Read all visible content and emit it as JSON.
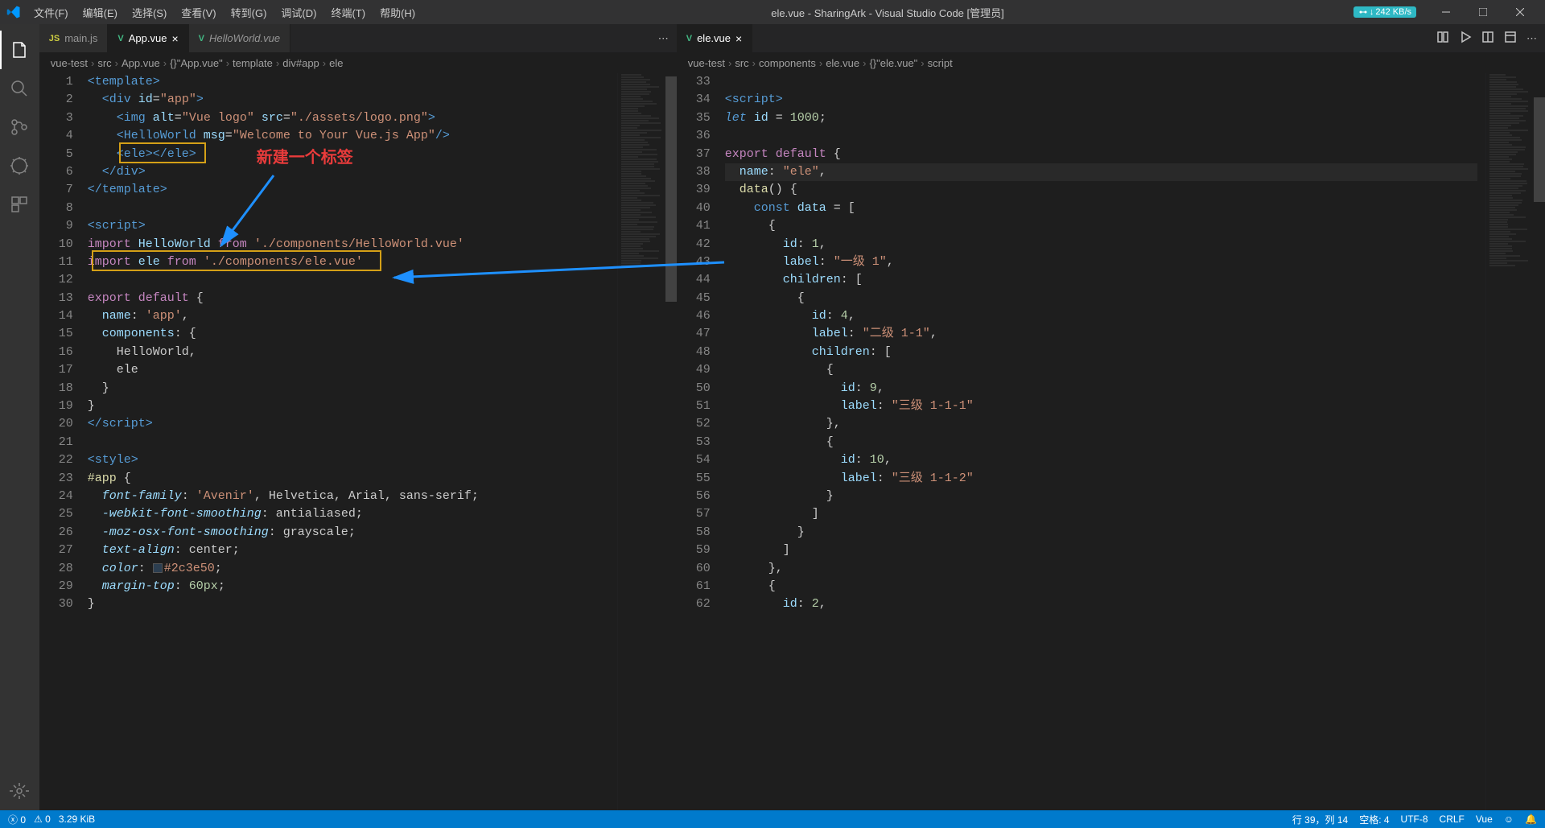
{
  "titlebar": {
    "menus": [
      "文件(F)",
      "编辑(E)",
      "选择(S)",
      "查看(V)",
      "转到(G)",
      "调试(D)",
      "终端(T)",
      "帮助(H)"
    ],
    "title": "ele.vue - SharingArk - Visual Studio Code [管理员]",
    "net_badge": "242 KB/s"
  },
  "tabs_left": [
    {
      "icon": "js",
      "label": "main.js",
      "active": false,
      "italic": false,
      "closeable": false
    },
    {
      "icon": "vue",
      "label": "App.vue",
      "active": true,
      "italic": false,
      "closeable": true
    },
    {
      "icon": "vue",
      "label": "HelloWorld.vue",
      "active": false,
      "italic": true,
      "closeable": false
    }
  ],
  "tabs_right": [
    {
      "icon": "vue",
      "label": "ele.vue",
      "active": true,
      "closeable": true
    }
  ],
  "breadcrumb_left": [
    "vue-test",
    "src",
    "App.vue",
    "{}\"App.vue\"",
    "template",
    "div#app",
    "ele"
  ],
  "breadcrumb_right": [
    "vue-test",
    "src",
    "components",
    "ele.vue",
    "{}\"ele.vue\"",
    "script"
  ],
  "annotation": {
    "label": "新建一个标签"
  },
  "code_left": {
    "start": 1,
    "lines": [
      [
        [
          "<",
          "c-tag"
        ],
        [
          "template",
          "c-tag"
        ],
        [
          ">",
          "c-tag"
        ]
      ],
      [
        [
          "  <",
          "c-tag"
        ],
        [
          "div",
          "c-tag"
        ],
        [
          " ",
          ""
        ],
        [
          "id",
          "c-attr"
        ],
        [
          "=",
          ""
        ],
        [
          "\"app\"",
          "c-str"
        ],
        [
          ">",
          "c-tag"
        ]
      ],
      [
        [
          "    <",
          "c-tag"
        ],
        [
          "img",
          "c-tag"
        ],
        [
          " ",
          ""
        ],
        [
          "alt",
          "c-attr"
        ],
        [
          "=",
          ""
        ],
        [
          "\"Vue logo\"",
          "c-str"
        ],
        [
          " ",
          ""
        ],
        [
          "src",
          "c-attr"
        ],
        [
          "=",
          ""
        ],
        [
          "\"./assets/logo.png\"",
          "c-str"
        ],
        [
          ">",
          "c-tag"
        ]
      ],
      [
        [
          "    <",
          "c-tag"
        ],
        [
          "HelloWorld",
          "c-tag"
        ],
        [
          " ",
          ""
        ],
        [
          "msg",
          "c-attr"
        ],
        [
          "=",
          ""
        ],
        [
          "\"Welcome to Your Vue.js App\"",
          "c-str"
        ],
        [
          "/>",
          "c-tag"
        ]
      ],
      [
        [
          "    <",
          "c-tag"
        ],
        [
          "ele",
          "c-tag"
        ],
        [
          "></",
          "c-tag"
        ],
        [
          "ele",
          "c-tag"
        ],
        [
          ">",
          "c-tag"
        ]
      ],
      [
        [
          "  </",
          "c-tag"
        ],
        [
          "div",
          "c-tag"
        ],
        [
          ">",
          "c-tag"
        ]
      ],
      [
        [
          "</",
          "c-tag"
        ],
        [
          "template",
          "c-tag"
        ],
        [
          ">",
          "c-tag"
        ]
      ],
      [],
      [
        [
          "<",
          "c-tag"
        ],
        [
          "script",
          "c-tag"
        ],
        [
          ">",
          "c-tag"
        ]
      ],
      [
        [
          "import",
          "c-kw"
        ],
        [
          " ",
          ""
        ],
        [
          "HelloWorld",
          "c-var"
        ],
        [
          " ",
          ""
        ],
        [
          "from",
          "c-kw"
        ],
        [
          " ",
          ""
        ],
        [
          "'./components/HelloWorld.vue'",
          "c-str"
        ]
      ],
      [
        [
          "import",
          "c-kw"
        ],
        [
          " ",
          ""
        ],
        [
          "ele",
          "c-var"
        ],
        [
          " ",
          ""
        ],
        [
          "from",
          "c-kw"
        ],
        [
          " ",
          ""
        ],
        [
          "'./components/ele.vue'",
          "c-str"
        ]
      ],
      [],
      [
        [
          "export",
          "c-kw"
        ],
        [
          " ",
          ""
        ],
        [
          "default",
          "c-kw"
        ],
        [
          " {",
          ""
        ]
      ],
      [
        [
          "  ",
          ""
        ],
        [
          "name",
          "c-var"
        ],
        [
          ": ",
          ""
        ],
        [
          "'app'",
          "c-str"
        ],
        [
          ",",
          ""
        ]
      ],
      [
        [
          "  ",
          ""
        ],
        [
          "components",
          "c-var"
        ],
        [
          ": {",
          ""
        ]
      ],
      [
        [
          "    ",
          ""
        ],
        [
          "HelloWorld",
          ""
        ],
        [
          ",",
          ""
        ]
      ],
      [
        [
          "    ",
          ""
        ],
        [
          "ele",
          ""
        ]
      ],
      [
        [
          "  }",
          ""
        ]
      ],
      [
        [
          "}",
          ""
        ]
      ],
      [
        [
          "</",
          "c-tag"
        ],
        [
          "script",
          "c-tag"
        ],
        [
          ">",
          "c-tag"
        ]
      ],
      [],
      [
        [
          "<",
          "c-tag"
        ],
        [
          "style",
          "c-tag"
        ],
        [
          ">",
          "c-tag"
        ]
      ],
      [
        [
          "#app",
          "c-fn"
        ],
        [
          " {",
          ""
        ]
      ],
      [
        [
          "  ",
          ""
        ],
        [
          "font-family",
          "c-var c-ital"
        ],
        [
          ": ",
          ""
        ],
        [
          "'Avenir'",
          "c-str"
        ],
        [
          ", Helvetica, Arial, sans-serif;",
          ""
        ]
      ],
      [
        [
          "  ",
          ""
        ],
        [
          "-webkit-font-smoothing",
          "c-var c-ital"
        ],
        [
          ": antialiased;",
          ""
        ]
      ],
      [
        [
          "  ",
          ""
        ],
        [
          "-moz-osx-font-smoothing",
          "c-var c-ital"
        ],
        [
          ": grayscale;",
          ""
        ]
      ],
      [
        [
          "  ",
          ""
        ],
        [
          "text-align",
          "c-var c-ital"
        ],
        [
          ": center;",
          ""
        ]
      ],
      [
        [
          "  ",
          ""
        ],
        [
          "color",
          "c-var c-ital"
        ],
        [
          ": ",
          ""
        ],
        [
          "SWATCH",
          ""
        ],
        [
          "#2c3e50",
          "c-str"
        ],
        [
          ";",
          ""
        ]
      ],
      [
        [
          "  ",
          ""
        ],
        [
          "margin-top",
          "c-var c-ital"
        ],
        [
          ": ",
          ""
        ],
        [
          "60",
          "c-num"
        ],
        [
          "px",
          "c-num"
        ],
        [
          ";",
          ""
        ]
      ],
      [
        [
          "}",
          ""
        ]
      ]
    ]
  },
  "code_right": {
    "start": 33,
    "lines": [
      [],
      [
        [
          "<",
          "c-tag"
        ],
        [
          "script",
          "c-tag"
        ],
        [
          ">",
          "c-tag"
        ]
      ],
      [
        [
          "let",
          "c-kw2 c-ital"
        ],
        [
          " ",
          ""
        ],
        [
          "id",
          "c-var"
        ],
        [
          " = ",
          ""
        ],
        [
          "1000",
          "c-num"
        ],
        [
          ";",
          ""
        ]
      ],
      [],
      [
        [
          "export",
          "c-kw"
        ],
        [
          " ",
          ""
        ],
        [
          "default",
          "c-kw"
        ],
        [
          " {",
          ""
        ]
      ],
      [
        [
          "  ",
          ""
        ],
        [
          "name",
          "c-var"
        ],
        [
          ": ",
          ""
        ],
        [
          "\"ele\"",
          "c-str"
        ],
        [
          ",",
          ""
        ]
      ],
      [
        [
          "  ",
          ""
        ],
        [
          "data",
          "c-fn"
        ],
        [
          "() {",
          ""
        ]
      ],
      [
        [
          "    ",
          ""
        ],
        [
          "const",
          "c-kw2"
        ],
        [
          " ",
          ""
        ],
        [
          "data",
          "c-var"
        ],
        [
          " = [",
          ""
        ]
      ],
      [
        [
          "      {",
          ""
        ]
      ],
      [
        [
          "        ",
          ""
        ],
        [
          "id",
          "c-var"
        ],
        [
          ": ",
          ""
        ],
        [
          "1",
          "c-num"
        ],
        [
          ",",
          ""
        ]
      ],
      [
        [
          "        ",
          ""
        ],
        [
          "label",
          "c-var"
        ],
        [
          ": ",
          ""
        ],
        [
          "\"一级 1\"",
          "c-str"
        ],
        [
          ",",
          ""
        ]
      ],
      [
        [
          "        ",
          ""
        ],
        [
          "children",
          "c-var"
        ],
        [
          ": [",
          ""
        ]
      ],
      [
        [
          "          {",
          ""
        ]
      ],
      [
        [
          "            ",
          ""
        ],
        [
          "id",
          "c-var"
        ],
        [
          ": ",
          ""
        ],
        [
          "4",
          "c-num"
        ],
        [
          ",",
          ""
        ]
      ],
      [
        [
          "            ",
          ""
        ],
        [
          "label",
          "c-var"
        ],
        [
          ": ",
          ""
        ],
        [
          "\"二级 1-1\"",
          "c-str"
        ],
        [
          ",",
          ""
        ]
      ],
      [
        [
          "            ",
          ""
        ],
        [
          "children",
          "c-var"
        ],
        [
          ": [",
          ""
        ]
      ],
      [
        [
          "              {",
          ""
        ]
      ],
      [
        [
          "                ",
          ""
        ],
        [
          "id",
          "c-var"
        ],
        [
          ": ",
          ""
        ],
        [
          "9",
          "c-num"
        ],
        [
          ",",
          ""
        ]
      ],
      [
        [
          "                ",
          ""
        ],
        [
          "label",
          "c-var"
        ],
        [
          ": ",
          ""
        ],
        [
          "\"三级 1-1-1\"",
          "c-str"
        ]
      ],
      [
        [
          "              },",
          ""
        ]
      ],
      [
        [
          "              {",
          ""
        ]
      ],
      [
        [
          "                ",
          ""
        ],
        [
          "id",
          "c-var"
        ],
        [
          ": ",
          ""
        ],
        [
          "10",
          "c-num"
        ],
        [
          ",",
          ""
        ]
      ],
      [
        [
          "                ",
          ""
        ],
        [
          "label",
          "c-var"
        ],
        [
          ": ",
          ""
        ],
        [
          "\"三级 1-1-2\"",
          "c-str"
        ]
      ],
      [
        [
          "              }",
          ""
        ]
      ],
      [
        [
          "            ]",
          ""
        ]
      ],
      [
        [
          "          }",
          ""
        ]
      ],
      [
        [
          "        ]",
          ""
        ]
      ],
      [
        [
          "      },",
          ""
        ]
      ],
      [
        [
          "      {",
          ""
        ]
      ],
      [
        [
          "        ",
          ""
        ],
        [
          "id",
          "c-var"
        ],
        [
          ": ",
          ""
        ],
        [
          "2",
          "c-num"
        ],
        [
          ",",
          ""
        ]
      ]
    ],
    "cursor_line_index": 5
  },
  "statusbar": {
    "errors": "0",
    "warnings": "0",
    "size": "3.29 KiB",
    "lncol": "行 39，列 14",
    "spaces": "空格: 4",
    "encoding": "UTF-8",
    "eol": "CRLF",
    "lang": "Vue"
  }
}
